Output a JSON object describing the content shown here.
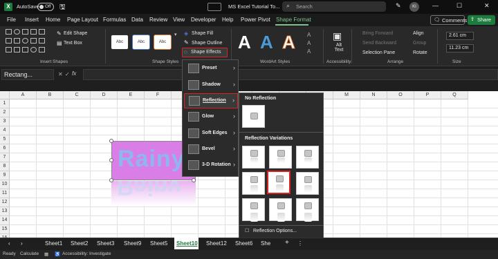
{
  "titlebar": {
    "autosave": "AutoSave",
    "toggle_state": "Off",
    "doc_title": "MS Excel Tutorial To...",
    "search_placeholder": "Search",
    "avatar_initials": "KI"
  },
  "menu_tabs": [
    "File",
    "Insert",
    "Home",
    "Page Layout",
    "Formulas",
    "Data",
    "Review",
    "View",
    "Developer",
    "Help",
    "Power Pivot",
    "Shape Format"
  ],
  "active_tab": "Shape Format",
  "buttons": {
    "comments": "Comments",
    "share": "Share"
  },
  "ribbon": {
    "insert_shapes": {
      "edit_shape": "Edit Shape",
      "text_box": "Text Box",
      "label": "Insert Shapes"
    },
    "shape_styles": {
      "preset_label": "Abc",
      "shape_fill": "Shape Fill",
      "shape_outline": "Shape Outline",
      "shape_effects": "Shape Effects",
      "label": "Shape Styles"
    },
    "wordart": {
      "label": "WordArt Styles",
      "letters": [
        "A",
        "A",
        "A"
      ]
    },
    "accessibility": {
      "alt_text": "Alt Text",
      "label": "Accessibility"
    },
    "arrange": {
      "bring_forward": "Bring Forward",
      "send_backward": "Send Backward",
      "selection_pane": "Selection Pane",
      "align": "Align",
      "group": "Group",
      "rotate": "Rotate",
      "label": "Arrange"
    },
    "size": {
      "height": "2.61 cm",
      "width": "11.23 cm",
      "label": "Size"
    }
  },
  "formula_bar": {
    "name_box": "Rectang...",
    "fx": "fx"
  },
  "columns": [
    "A",
    "B",
    "C",
    "D",
    "E",
    "F",
    "G",
    "H",
    "I",
    "J",
    "K",
    "L",
    "M",
    "N",
    "O",
    "P",
    "Q"
  ],
  "rows": [
    "1",
    "2",
    "3",
    "4",
    "5",
    "6",
    "7",
    "8",
    "9",
    "10",
    "11",
    "12",
    "13",
    "14",
    "15",
    "16"
  ],
  "shape": {
    "text": "Rainy"
  },
  "effects_menu": [
    {
      "label": "Preset"
    },
    {
      "label": "Shadow"
    },
    {
      "label": "Reflection"
    },
    {
      "label": "Glow"
    },
    {
      "label": "Soft Edges"
    },
    {
      "label": "Bevel"
    },
    {
      "label": "3-D Rotation"
    }
  ],
  "reflection_menu": {
    "no_reflection": "No Reflection",
    "variations": "Reflection Variations",
    "options": "Reflection Options..."
  },
  "sheets": [
    "Sheet1",
    "Sheet2",
    "Sheet3",
    "Sheet9",
    "Sheet5",
    "Sheet10",
    "Sheet12",
    "Sheet6",
    "She"
  ],
  "active_sheet": "Sheet10",
  "status": {
    "ready": "Ready",
    "calculate": "Calculate",
    "accessibility": "Accessibility: Investigate"
  },
  "colors": {
    "accent_green": "#7fc58f",
    "share_green": "#1e7b3e",
    "highlight_red": "#dd2222",
    "shape_fill": "#d97ee6",
    "shape_text": "#8fb7ef"
  }
}
